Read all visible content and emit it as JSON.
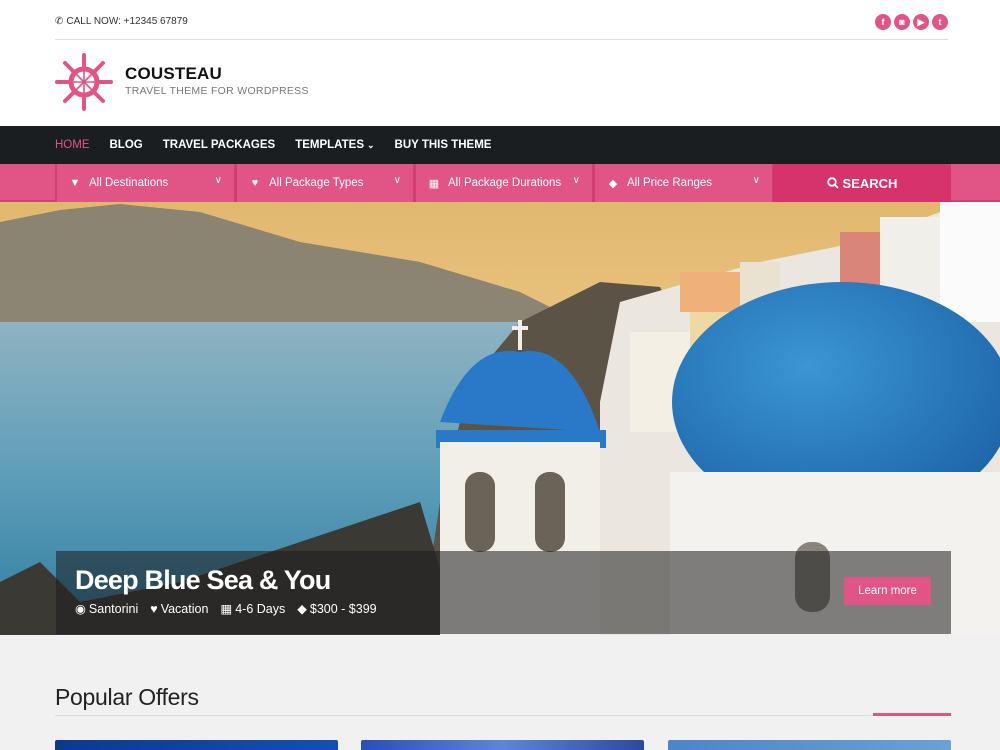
{
  "topbar": {
    "phone_icon": "phone-icon",
    "call_now": "CALL NOW: +12345 67879",
    "social": [
      {
        "name": "facebook",
        "glyph": "f"
      },
      {
        "name": "instagram",
        "glyph": "◙"
      },
      {
        "name": "youtube",
        "glyph": "▶"
      },
      {
        "name": "twitter",
        "glyph": "t"
      }
    ]
  },
  "brand": {
    "name": "COUSTEAU",
    "tagline": "TRAVEL THEME FOR WORDPRESS",
    "logo_icon": "ship-wheel-icon"
  },
  "nav": {
    "items": [
      {
        "label": "HOME",
        "active": true
      },
      {
        "label": "BLOG"
      },
      {
        "label": "TRAVEL PACKAGES"
      },
      {
        "label": "TEMPLATES",
        "dropdown": true
      },
      {
        "label": "BUY THIS THEME"
      }
    ],
    "dropdown_glyph": "⌄"
  },
  "filters": {
    "items": [
      {
        "label": "All Destinations",
        "icon": "map-marker-icon",
        "glyph": "⚲"
      },
      {
        "label": "All Package Types",
        "icon": "heart-icon",
        "glyph": "♥"
      },
      {
        "label": "All Package Durations",
        "icon": "calendar-icon",
        "glyph": "▦"
      },
      {
        "label": "All Price Ranges",
        "icon": "tag-icon",
        "glyph": "◆"
      }
    ],
    "chevron": "⌄",
    "search_label": "SEARCH",
    "search_glyph": "⚲"
  },
  "hero": {
    "title": "Deep Blue Sea & You",
    "meta": [
      {
        "icon": "map-marker-icon",
        "glyph": "⚲",
        "text": "Santorini"
      },
      {
        "icon": "heart-icon",
        "glyph": "♥",
        "text": "Vacation"
      },
      {
        "icon": "calendar-icon",
        "glyph": "▦",
        "text": "4-6 Days"
      },
      {
        "icon": "tag-icon",
        "glyph": "◆",
        "text": "$300 - $399"
      }
    ],
    "cta": "Learn more"
  },
  "popular": {
    "title": "Popular Offers"
  },
  "colors": {
    "accent": "#e05586",
    "search": "#d6336c",
    "nav_bg": "#1b1e21"
  }
}
